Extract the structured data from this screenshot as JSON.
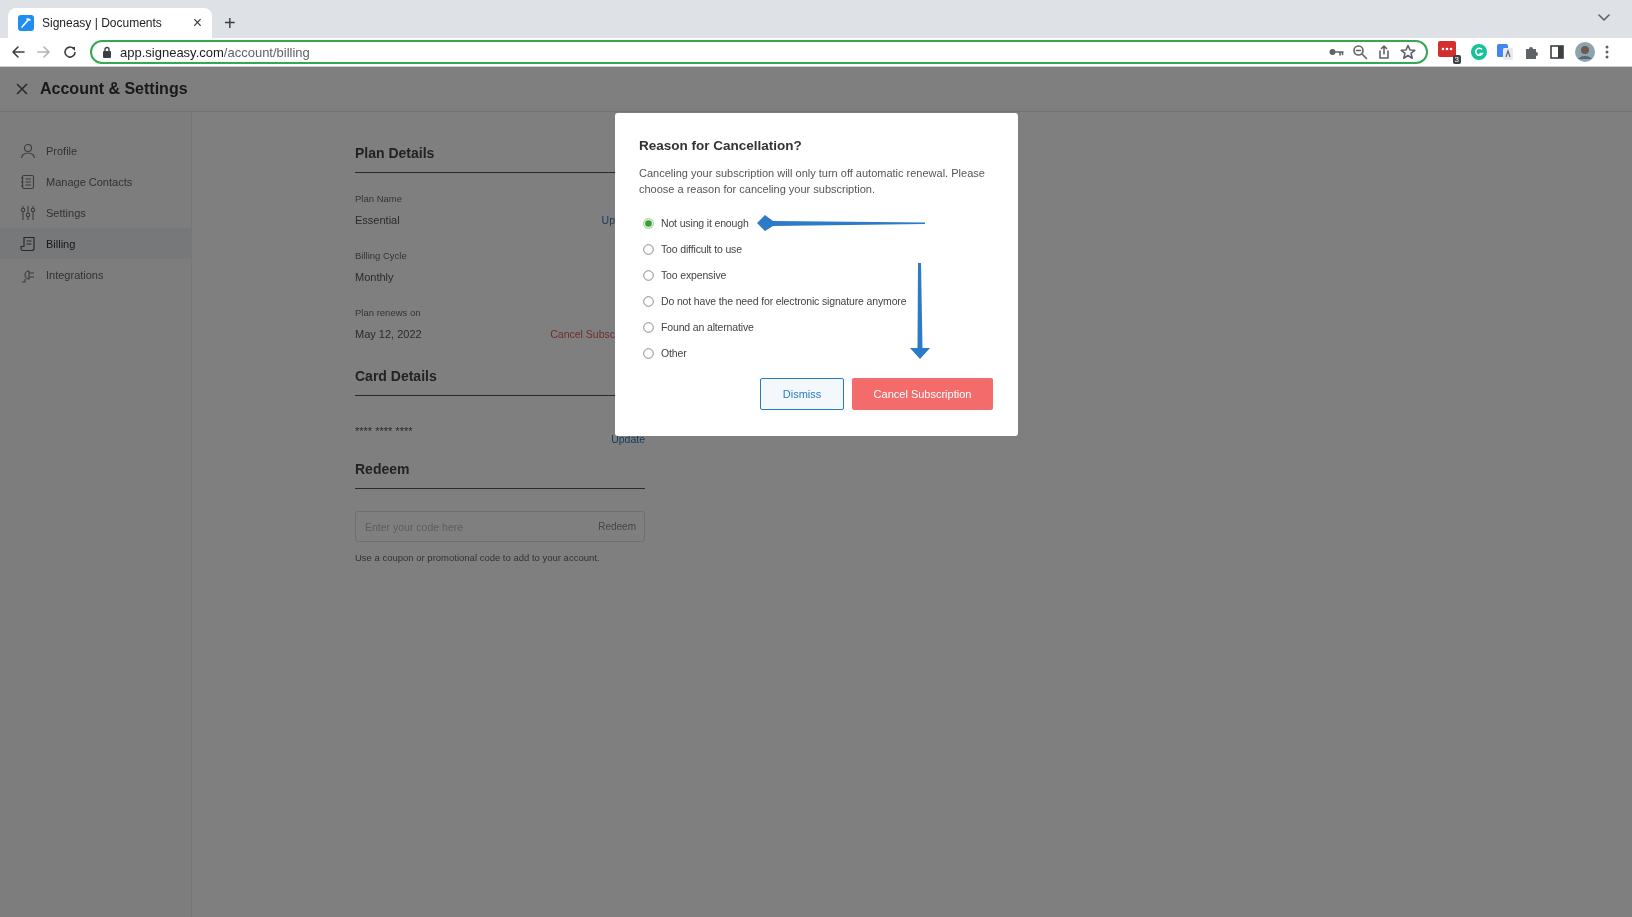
{
  "browser": {
    "tab": {
      "title": "Signeasy | Documents",
      "close": "×"
    },
    "new_tab": "+",
    "url": {
      "host": "app.signeasy.com",
      "path": "/account/billing"
    },
    "extension_badge": "3"
  },
  "header": {
    "title": "Account & Settings"
  },
  "sidebar": {
    "items": [
      {
        "label": "Profile",
        "selected": false
      },
      {
        "label": "Manage Contacts",
        "selected": false
      },
      {
        "label": "Settings",
        "selected": false
      },
      {
        "label": "Billing",
        "selected": true
      },
      {
        "label": "Integrations",
        "selected": false
      }
    ]
  },
  "plan_details": {
    "heading": "Plan Details",
    "fields": [
      {
        "label": "Plan Name",
        "value": "Essential",
        "action": "Up",
        "kind": "link"
      },
      {
        "label": "Billing Cycle",
        "value": "Monthly"
      },
      {
        "label": "Plan renews on",
        "value": "May 12, 2022",
        "action": "Cancel Subsc",
        "kind": "danger"
      }
    ]
  },
  "card_details": {
    "heading": "Card Details",
    "number": "**** **** ****",
    "action": "Update"
  },
  "redeem": {
    "heading": "Redeem",
    "placeholder": "Enter your code here",
    "button": "Redeem",
    "hint": "Use a coupon or promotional code to add to your account."
  },
  "dialog": {
    "title": "Reason for Cancellation?",
    "message": "Canceling your subscription will only turn off automatic renewal. Please choose a reason for canceling your subscription.",
    "options": [
      {
        "label": "Not using it enough",
        "selected": true
      },
      {
        "label": "Too difficult to use",
        "selected": false
      },
      {
        "label": "Too expensive",
        "selected": false
      },
      {
        "label": "Do not have the need for electronic signature anymore",
        "selected": false
      },
      {
        "label": "Found an alternative",
        "selected": false
      },
      {
        "label": "Other",
        "selected": false
      }
    ],
    "buttons": [
      {
        "label": "Dismiss",
        "kind": "secondary"
      },
      {
        "label": "Cancel Subscription",
        "kind": "primary"
      }
    ]
  }
}
